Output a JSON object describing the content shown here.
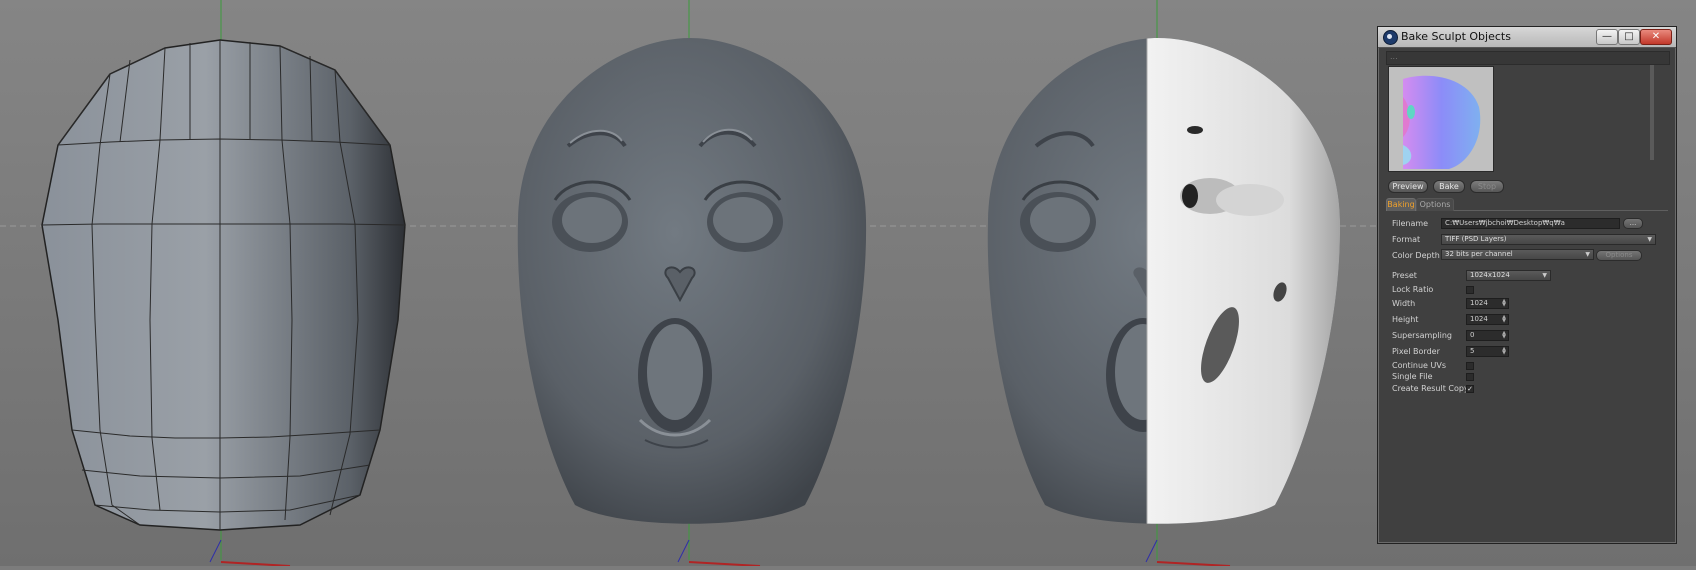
{
  "dialog": {
    "title": "Bake Sculpt Objects",
    "window_buttons": {
      "minimize": "—",
      "maximize": "□",
      "close": "✕"
    },
    "menu_strip": "...",
    "preview_image": "normal-map-preview",
    "buttons": {
      "preview": "Preview",
      "bake": "Bake",
      "stop": "Stop"
    },
    "tabs": [
      {
        "label": "Baking",
        "active": true
      },
      {
        "label": "Options",
        "active": false
      }
    ],
    "fields": {
      "filename": {
        "label": "Filename",
        "value": "C:₩Users₩jbchoi₩Desktop₩q₩a",
        "browse": "..."
      },
      "format": {
        "label": "Format",
        "value": "TIFF (PSD Layers)"
      },
      "color_depth": {
        "label": "Color Depth",
        "value": "32 bits per channel",
        "options_button": "Options"
      },
      "preset": {
        "label": "Preset",
        "value": "1024x1024"
      },
      "lock_ratio": {
        "label": "Lock Ratio",
        "checked": false
      },
      "width": {
        "label": "Width",
        "value": "1024"
      },
      "height": {
        "label": "Height",
        "value": "1024"
      },
      "supersampling": {
        "label": "Supersampling",
        "value": "0"
      },
      "pixel_border": {
        "label": "Pixel Border",
        "value": "5"
      },
      "continue_uvs": {
        "label": "Continue UVs",
        "checked": false
      },
      "single_file": {
        "label": "Single File",
        "checked": false
      },
      "create_result_copy": {
        "label": "Create Result Copy",
        "checked": true,
        "mark": "✓"
      }
    }
  },
  "colors": {
    "viewport_bg": "#7c7c7c",
    "dialog_bg": "#404040",
    "tab_active": "#f0a12a",
    "close_button": "#c2382a"
  }
}
